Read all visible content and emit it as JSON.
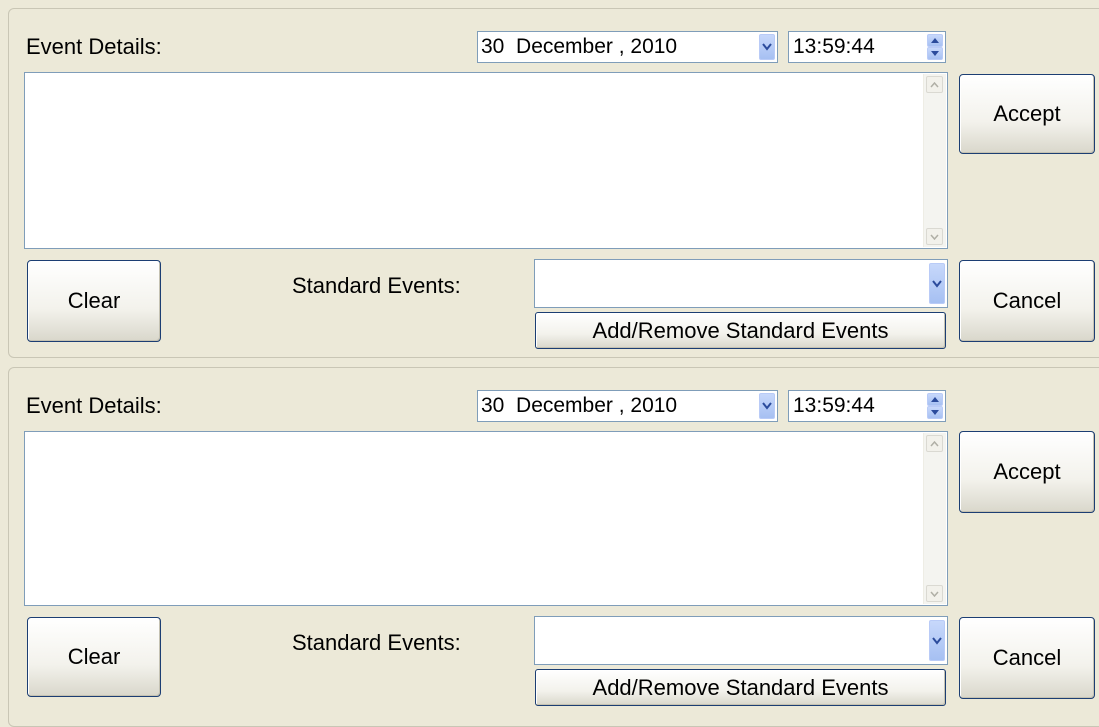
{
  "panels": [
    {
      "event_details_label": "Event Details:",
      "date_value": "30  December , 2010",
      "time_value": "13:59:44",
      "event_text": "",
      "accept_label": "Accept",
      "clear_label": "Clear",
      "standard_events_label": "Standard Events:",
      "standard_events_value": "",
      "add_remove_label": "Add/Remove Standard Events",
      "cancel_label": "Cancel"
    },
    {
      "event_details_label": "Event Details:",
      "date_value": "30  December , 2010",
      "time_value": "13:59:44",
      "event_text": "",
      "accept_label": "Accept",
      "clear_label": "Clear",
      "standard_events_label": "Standard Events:",
      "standard_events_value": "",
      "add_remove_label": "Add/Remove Standard Events",
      "cancel_label": "Cancel"
    }
  ],
  "colors": {
    "window_bg": "#ECE9D8",
    "field_border": "#7F9DB9",
    "button_border": "#1C3E73",
    "dropdown_button": "#A6C0F2"
  },
  "icons": {
    "dropdown": "chevron-down-icon",
    "spin_up": "spin-up-icon",
    "spin_down": "spin-down-icon",
    "scroll_up": "scroll-up-arrow-icon",
    "scroll_down": "scroll-down-arrow-icon"
  }
}
